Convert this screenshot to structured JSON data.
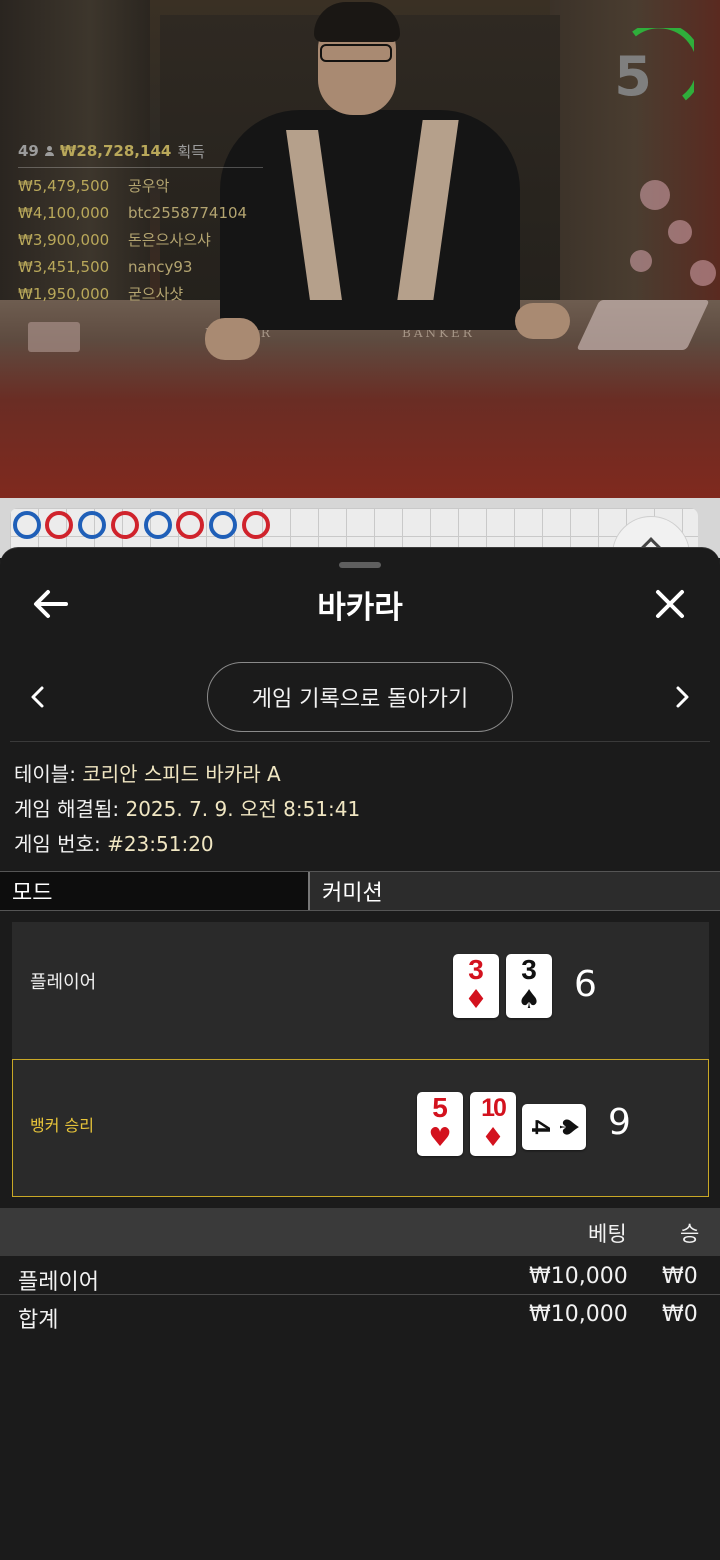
{
  "video": {
    "countdown": "5",
    "felt_left": "PLAYER",
    "felt_right": "BANKER",
    "winners": {
      "count": "49",
      "total": "₩28,728,144",
      "gain_label": "획득",
      "rows": [
        {
          "amount": "₩5,479,500",
          "name": "공우악"
        },
        {
          "amount": "₩4,100,000",
          "name": "btc2558774104"
        },
        {
          "amount": "₩3,900,000",
          "name": "돈은으사으샤"
        },
        {
          "amount": "₩3,451,500",
          "name": "nancy93"
        },
        {
          "amount": "₩1,950,000",
          "name": "굳으사샷"
        }
      ]
    }
  },
  "sheet": {
    "title": "바카라",
    "back_to_history": "게임 기록으로 돌아가기",
    "info": {
      "table_label": "테이블:",
      "table_value": "코리안 스피드 바카라 A",
      "resolved_label": "게임 해결됨:",
      "resolved_value": "2025. 7. 9. 오전 8:51:41",
      "number_label": "게임 번호:",
      "number_value": "#23:51:20"
    },
    "tabs": {
      "mode": "모드",
      "commission": "커미션"
    },
    "player": {
      "label": "플레이어",
      "score": "6",
      "cards": [
        {
          "rank": "3",
          "suit": "♦",
          "color": "red"
        },
        {
          "rank": "3",
          "suit": "♠",
          "color": "black"
        }
      ]
    },
    "banker": {
      "label": "뱅커 승리",
      "score": "9",
      "cards": [
        {
          "rank": "5",
          "suit": "♥",
          "color": "red"
        },
        {
          "rank": "10",
          "suit": "♦",
          "color": "red"
        },
        {
          "rank": "4",
          "suit": "♠",
          "color": "black",
          "sideways": true
        }
      ]
    },
    "bets": {
      "col_bet": "베팅",
      "col_win": "승",
      "rows": [
        {
          "name": "플레이어",
          "bet": "₩10,000",
          "win": "₩0"
        },
        {
          "name": "합계",
          "bet": "₩10,000",
          "win": "₩0"
        }
      ]
    }
  },
  "colors": {
    "winner_gold": "#b9a85a",
    "banker_win": "#e7c43a",
    "timer_green": "#2fae3b",
    "bead_player": "#1f5fb8",
    "bead_banker": "#d0232c"
  },
  "icons": [
    "back-arrow-icon",
    "close-icon",
    "chevron-left-icon",
    "chevron-right-icon",
    "person-icon"
  ]
}
